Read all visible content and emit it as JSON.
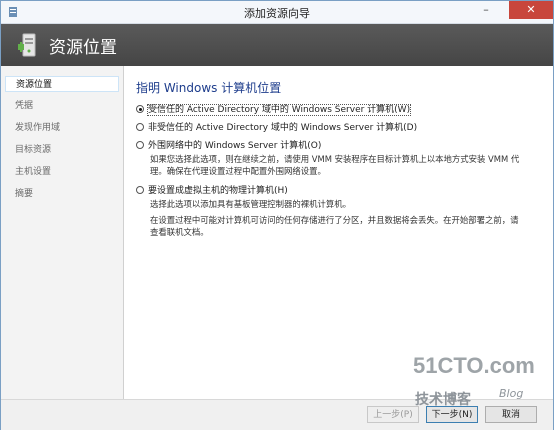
{
  "window": {
    "title": "添加资源向导",
    "minimize_glyph": "–",
    "close_glyph": "✕"
  },
  "header": {
    "title": "资源位置",
    "icon": "server-wizard-icon"
  },
  "sidebar": {
    "items": [
      {
        "label": "资源位置",
        "active": true
      },
      {
        "label": "凭据",
        "active": false
      },
      {
        "label": "发现作用域",
        "active": false
      },
      {
        "label": "目标资源",
        "active": false
      },
      {
        "label": "主机设置",
        "active": false
      },
      {
        "label": "摘要",
        "active": false
      }
    ]
  },
  "main": {
    "heading": "指明 Windows 计算机位置",
    "options": [
      {
        "label": "受信任的 Active Directory 域中的 Windows Server 计算机(W)",
        "checked": true
      },
      {
        "label": "非受信任的 Active Directory 域中的 Windows Server 计算机(D)",
        "checked": false
      },
      {
        "label": "外围网络中的 Windows Server 计算机(O)",
        "checked": false,
        "description": [
          "如果您选择此选项，则在继续之前，请使用 VMM 安装程序在目标计算机上以本地方式安装 VMM 代",
          "理。确保在代理设置过程中配置外围网络设置。"
        ]
      },
      {
        "label": "要设置成虚拟主机的物理计算机(H)",
        "checked": false,
        "description": [
          "选择此选项以添加具有基板管理控制器的裸机计算机。"
        ],
        "description2": [
          "在设置过程中可能对计算机可访问的任何存储进行了分区，并且数据将会丢失。在开始部署之前，请",
          "查看联机文档。"
        ]
      }
    ]
  },
  "footer": {
    "prev_label": "上一步(P)",
    "next_label": "下一步(N)",
    "cancel_label": "取消"
  },
  "watermark": {
    "line1": "51CTO.com",
    "line2": "技术博客",
    "line3": "Blog"
  },
  "colors": {
    "heading": "#1e3d8c",
    "header_bg": "#4f4f4f",
    "close_button": "#c8463c"
  }
}
